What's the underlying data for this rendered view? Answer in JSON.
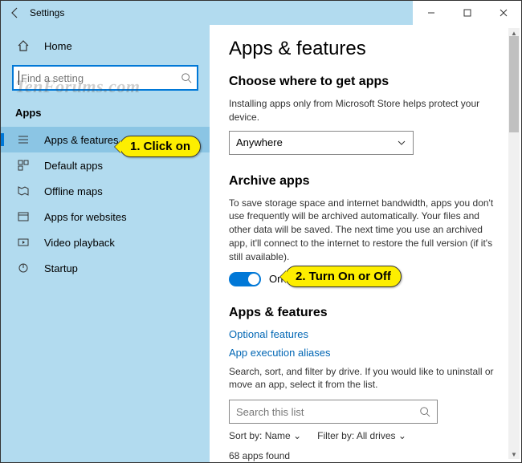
{
  "window": {
    "title": "Settings"
  },
  "watermark": "TenForums.com",
  "sidebar": {
    "home": "Home",
    "search_placeholder": "Find a setting",
    "category": "Apps",
    "items": [
      {
        "label": "Apps & features"
      },
      {
        "label": "Default apps"
      },
      {
        "label": "Offline maps"
      },
      {
        "label": "Apps for websites"
      },
      {
        "label": "Video playback"
      },
      {
        "label": "Startup"
      }
    ]
  },
  "main": {
    "page_title": "Apps & features",
    "section1": {
      "heading": "Choose where to get apps",
      "desc": "Installing apps only from Microsoft Store helps protect your device.",
      "dropdown_value": "Anywhere"
    },
    "section2": {
      "heading": "Archive apps",
      "desc": "To save storage space and internet bandwidth, apps you don't use frequently will be archived automatically. Your files and other data will be saved. The next time you use an archived app, it'll connect to the internet to restore the full version (if it's still available).",
      "toggle_state": "On"
    },
    "section3": {
      "heading": "Apps & features",
      "link1": "Optional features",
      "link2": "App execution aliases",
      "desc": "Search, sort, and filter by drive. If you would like to uninstall or move an app, select it from the list.",
      "search_placeholder": "Search this list",
      "sort_label": "Sort by:",
      "sort_value": "Name",
      "filter_label": "Filter by:",
      "filter_value": "All drives",
      "count_text": "68 apps found"
    }
  },
  "callouts": {
    "c1": "1. Click on",
    "c2": "2. Turn On or Off"
  }
}
